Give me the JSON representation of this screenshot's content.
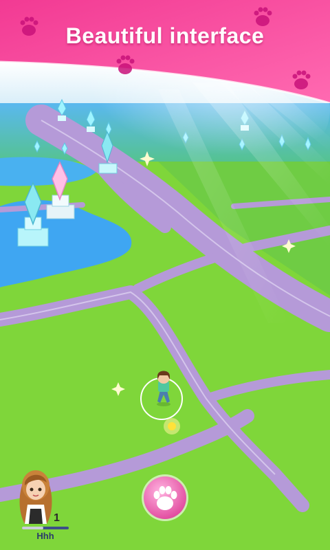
{
  "banner": {
    "title": "Beautiful interface",
    "color": "#f0308c"
  },
  "player": {
    "level": "1",
    "username": "Hhh",
    "progress": 0.45
  },
  "actions": {
    "paw_button_icon": "paw-icon"
  },
  "colors": {
    "grass": "#7fd63a",
    "road": "#b59ad8",
    "water": "#3fa6f2",
    "accent_pink": "#f0308c"
  }
}
